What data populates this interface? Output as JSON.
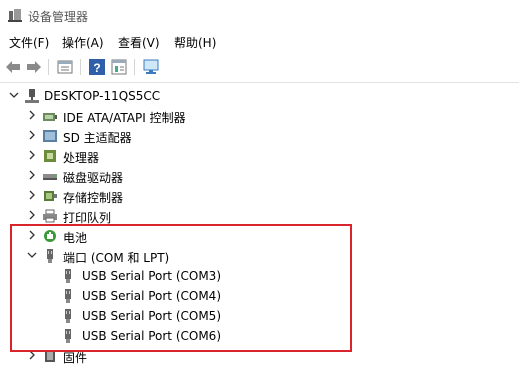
{
  "window": {
    "title": "设备管理器"
  },
  "menu": [
    "文件(F)",
    "操作(A)",
    "查看(V)",
    "帮助(H)"
  ],
  "toolbar": {
    "buttons": [
      "back-icon",
      "forward-icon",
      "properties-view-icon",
      "help-icon",
      "action-view-icon",
      "monitor-icon"
    ]
  },
  "tree": {
    "root": "DESKTOP-11QS5CC",
    "categories": [
      {
        "label": "IDE ATA/ATAPI 控制器",
        "expanded": false
      },
      {
        "label": "SD 主适配器",
        "expanded": false
      },
      {
        "label": "处理器",
        "expanded": false
      },
      {
        "label": "磁盘驱动器",
        "expanded": false
      },
      {
        "label": "存储控制器",
        "expanded": false
      },
      {
        "label": "打印队列",
        "expanded": false
      },
      {
        "label": "电池",
        "expanded": false
      },
      {
        "label": "端口 (COM 和 LPT)",
        "expanded": true,
        "children": [
          "USB Serial Port (COM3)",
          "USB Serial Port (COM4)",
          "USB Serial Port (COM5)",
          "USB Serial Port (COM6)"
        ]
      },
      {
        "label": "固件",
        "expanded": false
      }
    ]
  },
  "colors": {
    "highlight_border": "#d9242b",
    "help_icon": "#2f5fa8"
  }
}
